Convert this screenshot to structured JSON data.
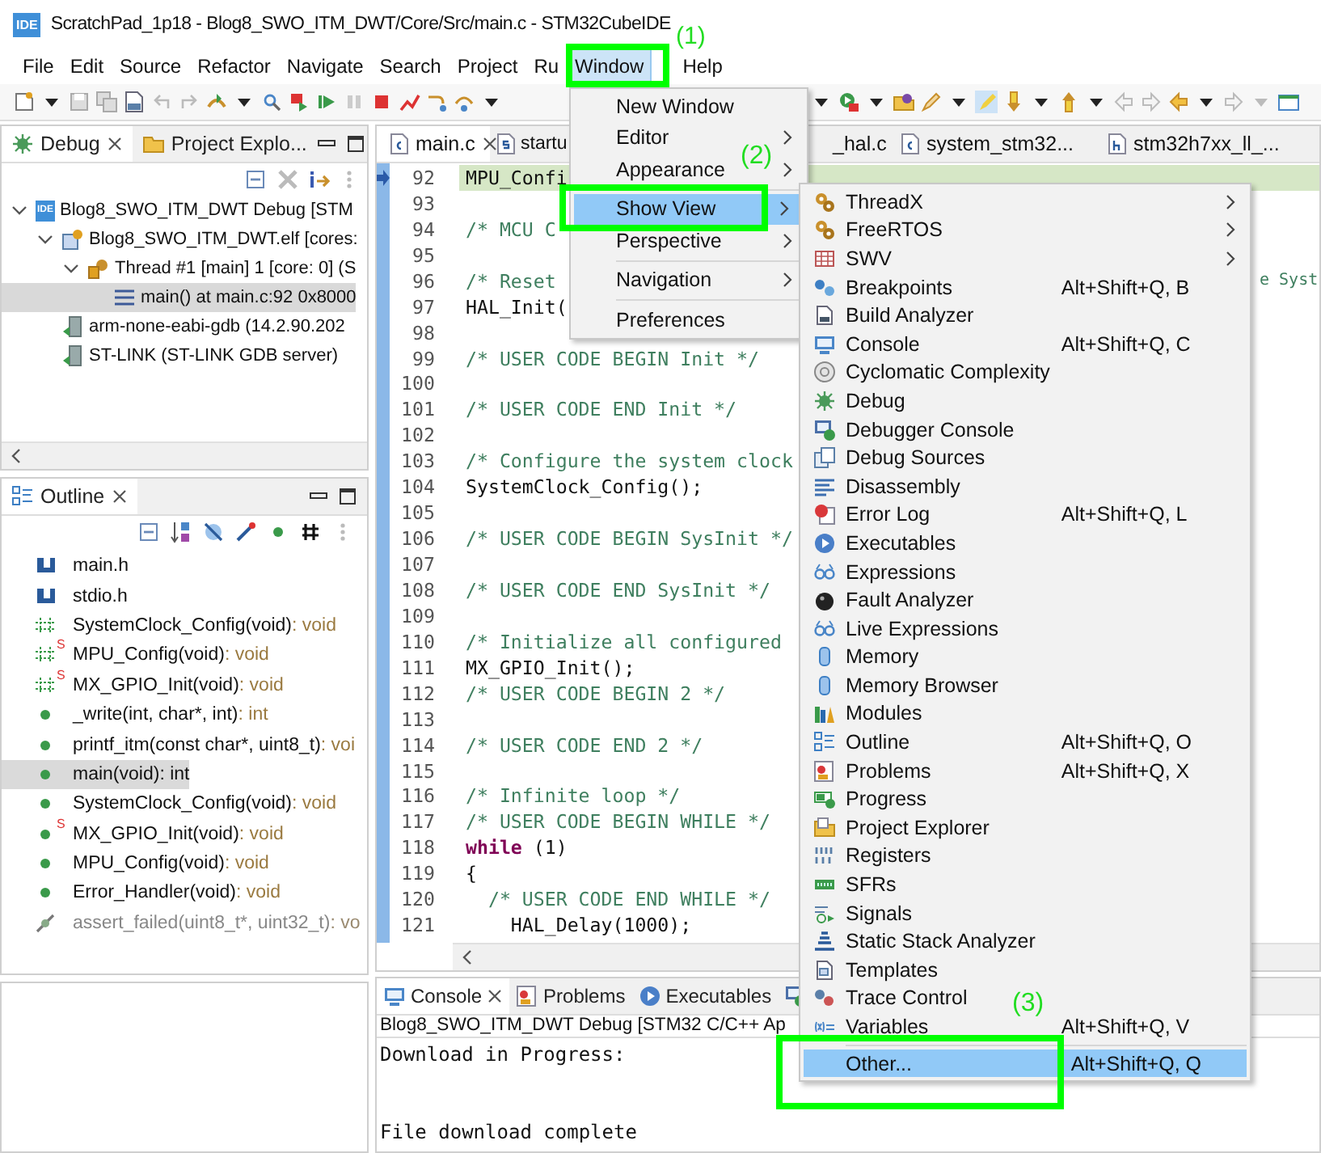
{
  "window": {
    "logo": "IDE",
    "title": "ScratchPad_1p18 - Blog8_SWO_ITM_DWT/Core/Src/main.c - STM32CubeIDE"
  },
  "menu_bar": [
    {
      "label": "File",
      "selected": false
    },
    {
      "label": "Edit",
      "selected": false
    },
    {
      "label": "Source",
      "selected": false
    },
    {
      "label": "Refactor",
      "selected": false
    },
    {
      "label": "Navigate",
      "selected": false
    },
    {
      "label": "Search",
      "selected": false
    },
    {
      "label": "Project",
      "selected": false
    },
    {
      "label": "Ru",
      "selected": false
    },
    {
      "label": "Window",
      "selected": true
    },
    {
      "label": "Help",
      "selected": false
    }
  ],
  "debug_panel": {
    "tabs": [
      {
        "label": "Debug",
        "selected": true
      },
      {
        "label": "Project Explo...",
        "selected": false
      }
    ],
    "tree": [
      {
        "label": "Blog8_SWO_ITM_DWT Debug [STM",
        "kind": "launch",
        "badge": "IDE",
        "selected": false,
        "expanded": true,
        "children": [
          {
            "label": "Blog8_SWO_ITM_DWT.elf [cores:",
            "kind": "process",
            "selected": false,
            "expanded": true,
            "children": [
              {
                "label": "Thread #1 [main] 1 [core: 0] (S",
                "kind": "thread",
                "selected": false,
                "expanded": true,
                "children": [
                  {
                    "label": "main() at main.c:92 0x8000",
                    "kind": "frame",
                    "selected": true
                  }
                ]
              }
            ]
          },
          {
            "label": "arm-none-eabi-gdb (14.2.90.202",
            "kind": "server",
            "selected": false
          },
          {
            "label": "ST-LINK (ST-LINK GDB server)",
            "kind": "server",
            "selected": false
          }
        ]
      }
    ]
  },
  "outline_panel": {
    "tab": "Outline",
    "items": [
      {
        "name": "main.h",
        "kind": "include",
        "selected": false
      },
      {
        "name": "stdio.h",
        "kind": "include",
        "selected": false
      },
      {
        "name": "SystemClock_Config(void)",
        "type": ": void",
        "kind": "declaration",
        "selected": false
      },
      {
        "name": "MPU_Config(void)",
        "type": ": void",
        "kind": "declaration",
        "badge": "S",
        "selected": false
      },
      {
        "name": "MX_GPIO_Init(void)",
        "type": ": void",
        "kind": "declaration",
        "badge": "S",
        "selected": false
      },
      {
        "name": "_write(int, char*, int)",
        "type": ": int",
        "kind": "function",
        "selected": false
      },
      {
        "name": "printf_itm(const char*, uint8_t)",
        "type": ": voi",
        "kind": "function",
        "selected": false
      },
      {
        "name": "main(void)",
        "type": ": int",
        "kind": "function",
        "selected": true
      },
      {
        "name": "SystemClock_Config(void)",
        "type": ": void",
        "kind": "function",
        "selected": false
      },
      {
        "name": "MX_GPIO_Init(void)",
        "type": ": void",
        "kind": "function",
        "badge": "S",
        "selected": false
      },
      {
        "name": "MPU_Config(void)",
        "type": ": void",
        "kind": "function",
        "selected": false
      },
      {
        "name": "Error_Handler(void)",
        "type": ": void",
        "kind": "function",
        "selected": false
      },
      {
        "name": "assert_failed(uint8_t*, uint32_t)",
        "type": ": vo",
        "kind": "inactive",
        "selected": false
      }
    ]
  },
  "editor": {
    "tabs": [
      {
        "label": "main.c",
        "kind": "c",
        "selected": true
      },
      {
        "label": "startu",
        "kind": "s",
        "selected": false
      },
      {
        "label": "_hal.c",
        "kind": "hidden",
        "selected": false
      },
      {
        "label": "system_stm32...",
        "kind": "c",
        "selected": false
      },
      {
        "label": "stm32h7xx_ll_...",
        "kind": "h",
        "selected": false
      }
    ],
    "lines": [
      {
        "n": "92",
        "code": "MPU_Confi",
        "current": true
      },
      {
        "n": "93",
        "current": false
      },
      {
        "n": "94",
        "comment": "/* MCU C",
        "current": false
      },
      {
        "n": "95",
        "current": false
      },
      {
        "n": "96",
        "comment": "/* Reset ",
        "tail": "e Syst",
        "current": false
      },
      {
        "n": "97",
        "code": "HAL_Init(",
        "current": false
      },
      {
        "n": "98",
        "current": false
      },
      {
        "n": "99",
        "comment": "/* USER CODE BEGIN Init */",
        "current": false
      },
      {
        "n": "100",
        "current": false
      },
      {
        "n": "101",
        "comment": "/* USER CODE END Init */",
        "current": false
      },
      {
        "n": "102",
        "current": false
      },
      {
        "n": "103",
        "comment": "/* Configure the system clock",
        "current": false
      },
      {
        "n": "104",
        "code": "SystemClock_Config();",
        "current": false
      },
      {
        "n": "105",
        "current": false
      },
      {
        "n": "106",
        "comment": "/* USER CODE BEGIN SysInit */",
        "current": false
      },
      {
        "n": "107",
        "current": false
      },
      {
        "n": "108",
        "comment": "/* USER CODE END SysInit */",
        "current": false
      },
      {
        "n": "109",
        "current": false
      },
      {
        "n": "110",
        "comment": "/* Initialize all configured",
        "current": false
      },
      {
        "n": "111",
        "code": "MX_GPIO_Init();",
        "current": false
      },
      {
        "n": "112",
        "comment": "/* USER CODE BEGIN 2 */",
        "current": false
      },
      {
        "n": "113",
        "current": false
      },
      {
        "n": "114",
        "comment": "/* USER CODE END 2 */",
        "current": false
      },
      {
        "n": "115",
        "current": false
      },
      {
        "n": "116",
        "comment": "/* Infinite loop */",
        "current": false
      },
      {
        "n": "117",
        "comment": "/* USER CODE BEGIN WHILE */",
        "current": false
      },
      {
        "n": "118",
        "keyword": "while",
        "code": " (1)",
        "current": false
      },
      {
        "n": "119",
        "code": "{",
        "current": false
      },
      {
        "n": "120",
        "comment": "  /* USER CODE END WHILE */",
        "current": false
      },
      {
        "n": "121",
        "code": "    HAL_Delay(1000);",
        "current": false
      }
    ]
  },
  "console_panel": {
    "tabs": [
      {
        "label": "Console",
        "kind": "console",
        "selected": true
      },
      {
        "label": "Problems",
        "kind": "problems",
        "selected": false
      },
      {
        "label": "Executables",
        "kind": "executables",
        "selected": false
      },
      {
        "kind": "other",
        "selected": false
      }
    ],
    "header": "Blog8_SWO_ITM_DWT Debug [STM32 C/C++ Ap",
    "lines": [
      {
        "text": "Download in Progress:",
        "kind": "line"
      },
      {
        "text": "File download complete",
        "kind": "after-gap"
      }
    ]
  },
  "window_menu": [
    {
      "label": "New Window",
      "kind": "item",
      "selected": false,
      "submenu": false
    },
    {
      "label": "Editor",
      "kind": "item",
      "selected": false,
      "submenu": true
    },
    {
      "label": "Appearance",
      "kind": "item",
      "selected": false,
      "submenu": true
    },
    {
      "kind": "separator"
    },
    {
      "label": "Show View",
      "kind": "item",
      "selected": true,
      "submenu": true
    },
    {
      "label": "Perspective",
      "kind": "item",
      "selected": false,
      "submenu": true
    },
    {
      "kind": "separator"
    },
    {
      "label": "Navigation",
      "kind": "item",
      "selected": false,
      "submenu": true
    },
    {
      "kind": "separator"
    },
    {
      "label": "Preferences",
      "kind": "item",
      "selected": false,
      "submenu": false
    }
  ],
  "show_view_menu": [
    {
      "label": "ThreadX",
      "kind": "item",
      "submenu": true,
      "selected": false
    },
    {
      "label": "FreeRTOS",
      "kind": "item",
      "submenu": true,
      "selected": false
    },
    {
      "label": "SWV",
      "kind": "item",
      "submenu": true,
      "selected": false
    },
    {
      "label": "Breakpoints",
      "kind": "item",
      "shortcut": "Alt+Shift+Q, B",
      "submenu": false,
      "selected": false
    },
    {
      "label": "Build Analyzer",
      "kind": "item",
      "submenu": false,
      "selected": false
    },
    {
      "label": "Console",
      "kind": "item",
      "shortcut": "Alt+Shift+Q, C",
      "submenu": false,
      "selected": false
    },
    {
      "label": "Cyclomatic Complexity",
      "kind": "item",
      "submenu": false,
      "selected": false
    },
    {
      "label": "Debug",
      "kind": "item",
      "submenu": false,
      "selected": false
    },
    {
      "label": "Debugger Console",
      "kind": "item",
      "submenu": false,
      "selected": false
    },
    {
      "label": "Debug Sources",
      "kind": "item",
      "submenu": false,
      "selected": false
    },
    {
      "label": "Disassembly",
      "kind": "item",
      "submenu": false,
      "selected": false
    },
    {
      "label": "Error Log",
      "kind": "item",
      "shortcut": "Alt+Shift+Q, L",
      "submenu": false,
      "selected": false
    },
    {
      "label": "Executables",
      "kind": "item",
      "submenu": false,
      "selected": false
    },
    {
      "label": "Expressions",
      "kind": "item",
      "submenu": false,
      "selected": false
    },
    {
      "label": "Fault Analyzer",
      "kind": "item",
      "submenu": false,
      "selected": false
    },
    {
      "label": "Live Expressions",
      "kind": "item",
      "submenu": false,
      "selected": false
    },
    {
      "label": "Memory",
      "kind": "item",
      "submenu": false,
      "selected": false
    },
    {
      "label": "Memory Browser",
      "kind": "item",
      "submenu": false,
      "selected": false
    },
    {
      "label": "Modules",
      "kind": "item",
      "submenu": false,
      "selected": false
    },
    {
      "label": "Outline",
      "kind": "item",
      "shortcut": "Alt+Shift+Q, O",
      "submenu": false,
      "selected": false
    },
    {
      "label": "Problems",
      "kind": "item",
      "shortcut": "Alt+Shift+Q, X",
      "submenu": false,
      "selected": false
    },
    {
      "label": "Progress",
      "kind": "item",
      "submenu": false,
      "selected": false
    },
    {
      "label": "Project Explorer",
      "kind": "item",
      "submenu": false,
      "selected": false
    },
    {
      "label": "Registers",
      "kind": "item",
      "submenu": false,
      "selected": false
    },
    {
      "label": "SFRs",
      "kind": "item",
      "submenu": false,
      "selected": false
    },
    {
      "label": "Signals",
      "kind": "item",
      "submenu": false,
      "selected": false
    },
    {
      "label": "Static Stack Analyzer",
      "kind": "item",
      "submenu": false,
      "selected": false
    },
    {
      "label": "Templates",
      "kind": "item",
      "submenu": false,
      "selected": false
    },
    {
      "label": "Trace Control",
      "kind": "item",
      "submenu": false,
      "selected": false
    },
    {
      "label": "Variables",
      "kind": "item",
      "shortcut": "Alt+Shift+Q, V",
      "submenu": false,
      "selected": false
    },
    {
      "kind": "separator"
    },
    {
      "label": "Other...",
      "kind": "item",
      "shortcut": "Alt+Shift+Q, Q",
      "submenu": false,
      "selected": true
    }
  ],
  "annotations": [
    {
      "label": "(1)"
    },
    {
      "label": "(2)"
    },
    {
      "label": "(3)"
    }
  ]
}
